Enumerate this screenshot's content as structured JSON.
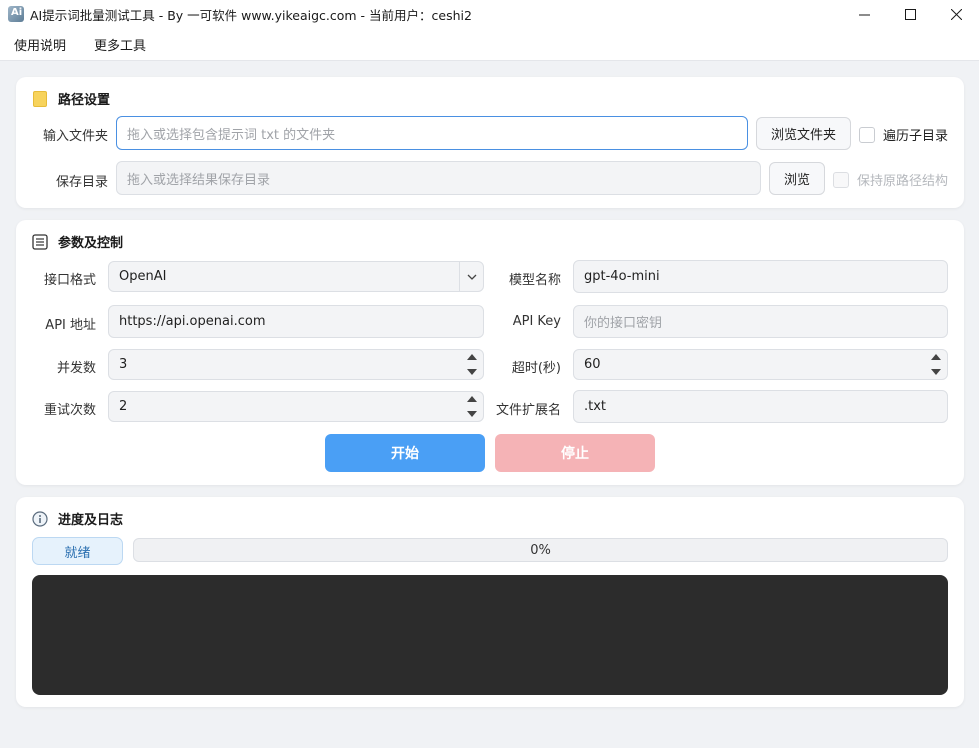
{
  "window": {
    "title": "AI提示词批量测试工具 - By 一可软件 www.yikeaigc.com  -  当前用户：ceshi2",
    "icon_letter": "Ai"
  },
  "menu": {
    "items": [
      "使用说明",
      "更多工具"
    ]
  },
  "path_section": {
    "title": "路径设置",
    "input_folder_label": "输入文件夹",
    "input_folder_placeholder": "拖入或选择包含提示词 txt 的文件夹",
    "browse_folder_label": "浏览文件夹",
    "recurse_label": "遍历子目录",
    "save_dir_label": "保存目录",
    "save_dir_placeholder": "拖入或选择结果保存目录",
    "browse_label": "浏览",
    "keep_structure_label": "保持原路径结构"
  },
  "params_section": {
    "title": "参数及控制",
    "api_format_label": "接口格式",
    "api_format_value": "OpenAI",
    "model_name_label": "模型名称",
    "model_name_value": "gpt-4o-mini",
    "api_url_label": "API 地址",
    "api_url_value": "https://api.openai.com",
    "api_key_label": "API Key",
    "api_key_placeholder": "你的接口密钥",
    "concurrency_label": "并发数",
    "concurrency_value": "3",
    "timeout_label": "超时(秒)",
    "timeout_value": "60",
    "retries_label": "重试次数",
    "retries_value": "2",
    "extension_label": "文件扩展名",
    "extension_value": ".txt",
    "start_label": "开始",
    "stop_label": "停止"
  },
  "progress_section": {
    "title": "进度及日志",
    "status": "就绪",
    "progress_text": "0%",
    "progress_fraction": 0
  },
  "colors": {
    "accent": "#4a9ff5",
    "stop_disabled": "#f5b3b6",
    "log_bg": "#2c2c2c",
    "folder_icon": "#f7d35c"
  }
}
